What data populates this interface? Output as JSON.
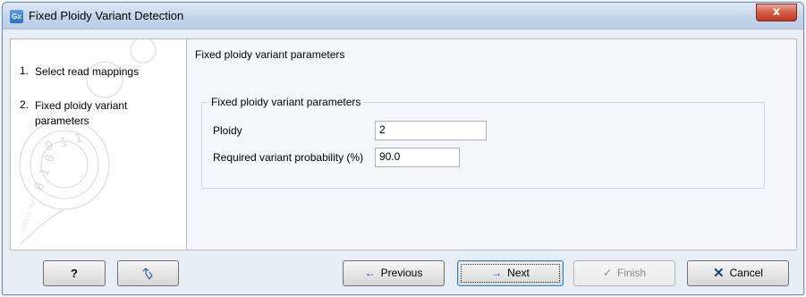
{
  "window": {
    "app_icon": "Gx",
    "title": "Fixed Ploidy Variant Detection",
    "close_symbol": "x"
  },
  "sidebar": {
    "steps": [
      {
        "number": "1.",
        "label": "Select read mappings",
        "active": false
      },
      {
        "number": "2.",
        "label": "Fixed ploidy variant parameters",
        "active": true
      }
    ]
  },
  "main": {
    "panel_title": "Fixed ploidy variant parameters",
    "group": {
      "title": "Fixed ploidy variant parameters",
      "fields": [
        {
          "label": "Ploidy",
          "value": "2"
        },
        {
          "label": "Required variant probability (%)",
          "value": "90.0"
        }
      ]
    }
  },
  "buttons": {
    "help": "?",
    "reset_icon": "reset-icon",
    "previous": "Previous",
    "next": "Next",
    "finish": "Finish",
    "cancel": "Cancel"
  },
  "colors": {
    "title_bar": "#c4d5ea",
    "close_button": "#c0391f",
    "arrow_blue": "#1b4c9c",
    "cancel_x": "#1f3f8a"
  }
}
